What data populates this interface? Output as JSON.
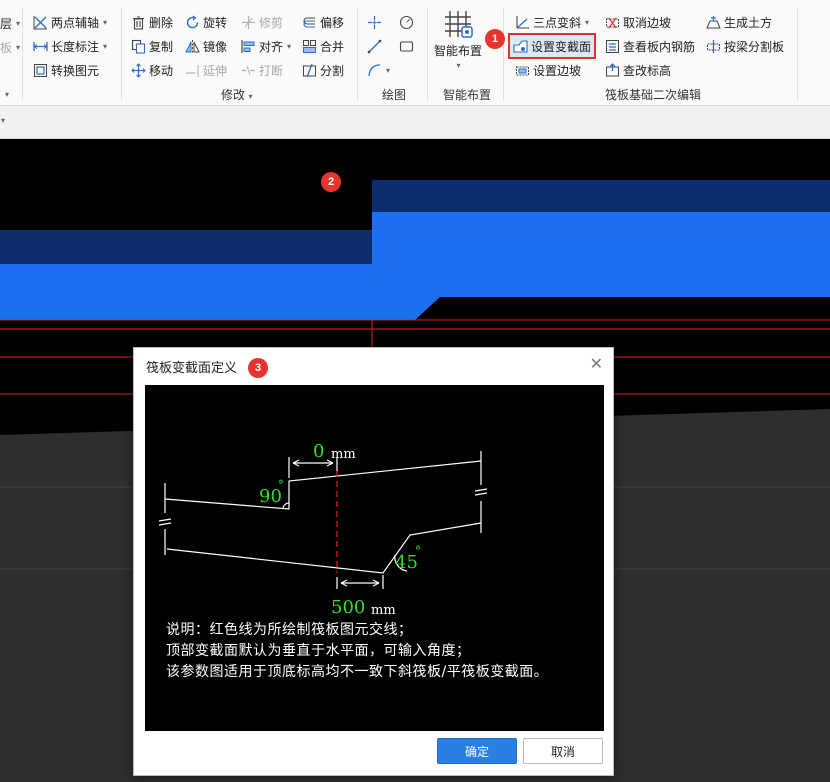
{
  "ribbon": {
    "left_partial": [
      "层",
      "板"
    ],
    "axis_group": {
      "two_point_axis": "两点辅轴",
      "length_dimension": "长度标注",
      "convert_element": "转换图元"
    },
    "modify_group": {
      "label": "修改",
      "delete": "删除",
      "rotate": "旋转",
      "trim": "修剪",
      "offset": "偏移",
      "copy": "复制",
      "mirror": "镜像",
      "align": "对齐",
      "merge": "合并",
      "move": "移动",
      "extend": "延伸",
      "break": "打断",
      "split": "分割"
    },
    "draw_group": {
      "label": "绘图"
    },
    "smart_group": {
      "button": "智能布置",
      "label": "智能布置"
    },
    "raft_group": {
      "label": "筏板基础二次编辑",
      "three_point_slope": "三点变斜",
      "cancel_slope": "取消边坡",
      "generate_earthwork": "生成土方",
      "set_variable_section": "设置变截面",
      "view_rebar": "查看板内钢筋",
      "split_by_beam": "按梁分割板",
      "set_slope": "设置边坡",
      "modify_elevation": "查改标高"
    }
  },
  "badges": [
    "1",
    "2",
    "3"
  ],
  "dialog": {
    "title": "筏板变截面定义",
    "close": "✕",
    "diagram": {
      "top_offset": "0",
      "top_unit": "mm",
      "top_angle": "90",
      "bottom_angle": "45",
      "bottom_offset": "500",
      "bottom_unit": "mm",
      "degree": "°"
    },
    "notes": [
      "说明：红色线为所绘制筏板图元交线；",
      "顶部变截面默认为垂直于水平面，可输入角度；",
      "该参数图适用于顶底标高均不一致下斜筏板/平筏板变截面。"
    ],
    "ok": "确定",
    "cancel": "取消"
  },
  "colors": {
    "canvas_bg": "#000000",
    "slab_bright": "#1e6ff0",
    "slab_dark": "#0c2e6e",
    "red_line": "#e02020",
    "primary_button": "#2a80e0",
    "badge": "#e8342f",
    "diagram_green": "#2ee02e"
  }
}
